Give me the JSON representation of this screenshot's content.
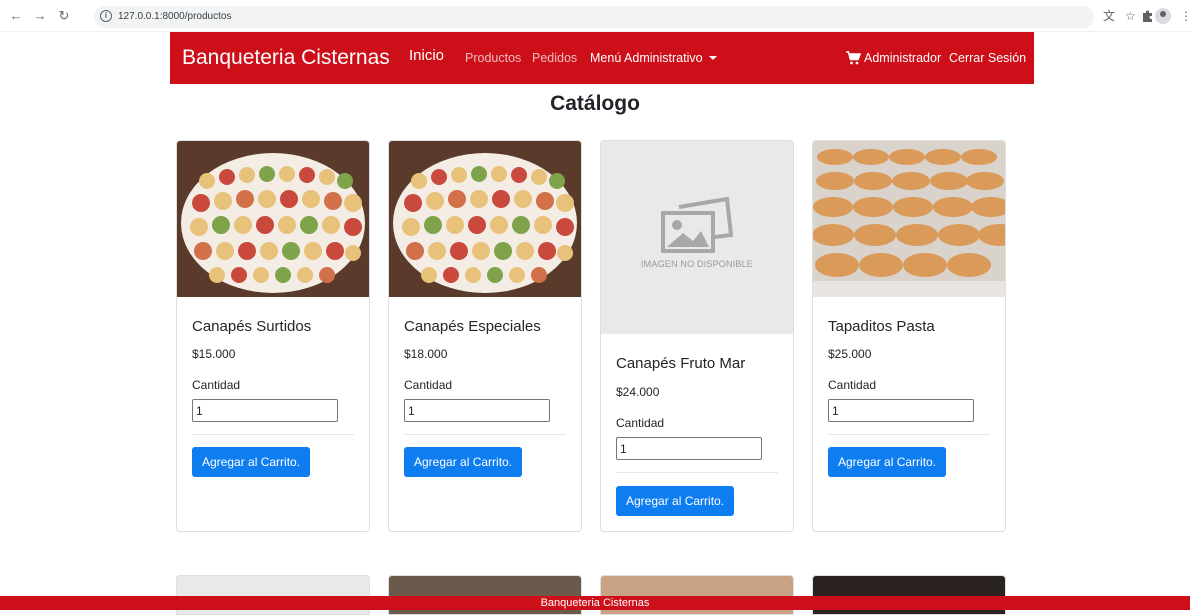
{
  "browser": {
    "url": "127.0.0.1:8000/productos",
    "back_icon": "arrow-left-icon",
    "forward_icon": "arrow-right-icon",
    "reload_icon": "reload-icon"
  },
  "navbar": {
    "brand": "Banqueteria Cisternas",
    "inicio": "Inicio",
    "productos": "Productos",
    "pedidos": "Pedidos",
    "menu_admin": "Menú Administrativo",
    "admin": "Administrador",
    "logout": "Cerrar Sesión",
    "bg_color": "#cc0f19"
  },
  "page": {
    "title": "Catálogo"
  },
  "products": [
    {
      "name": "Canapés Surtidos",
      "price": "$15.000",
      "qty_label": "Cantidad",
      "qty": "1",
      "button": "Agregar al Carrito.",
      "image": "canapes-photo"
    },
    {
      "name": "Canapés Especiales",
      "price": "$18.000",
      "qty_label": "Cantidad",
      "qty": "1",
      "button": "Agregar al Carrito.",
      "image": "canapes-photo"
    },
    {
      "name": "Canapés Fruto Mar",
      "price": "$24.000",
      "qty_label": "Cantidad",
      "qty": "1",
      "button": "Agregar al Carrito.",
      "image": "placeholder",
      "placeholder_text": "IMAGEN NO DISPONIBLE"
    },
    {
      "name": "Tapaditos Pasta",
      "price": "$25.000",
      "qty_label": "Cantidad",
      "qty": "1",
      "button": "Agregar al Carrito.",
      "image": "sandwiches-photo"
    }
  ],
  "footer": {
    "text": "Banqueteria Cisternas"
  },
  "colors": {
    "accent": "#cc0f19",
    "button": "#0d7df0"
  }
}
